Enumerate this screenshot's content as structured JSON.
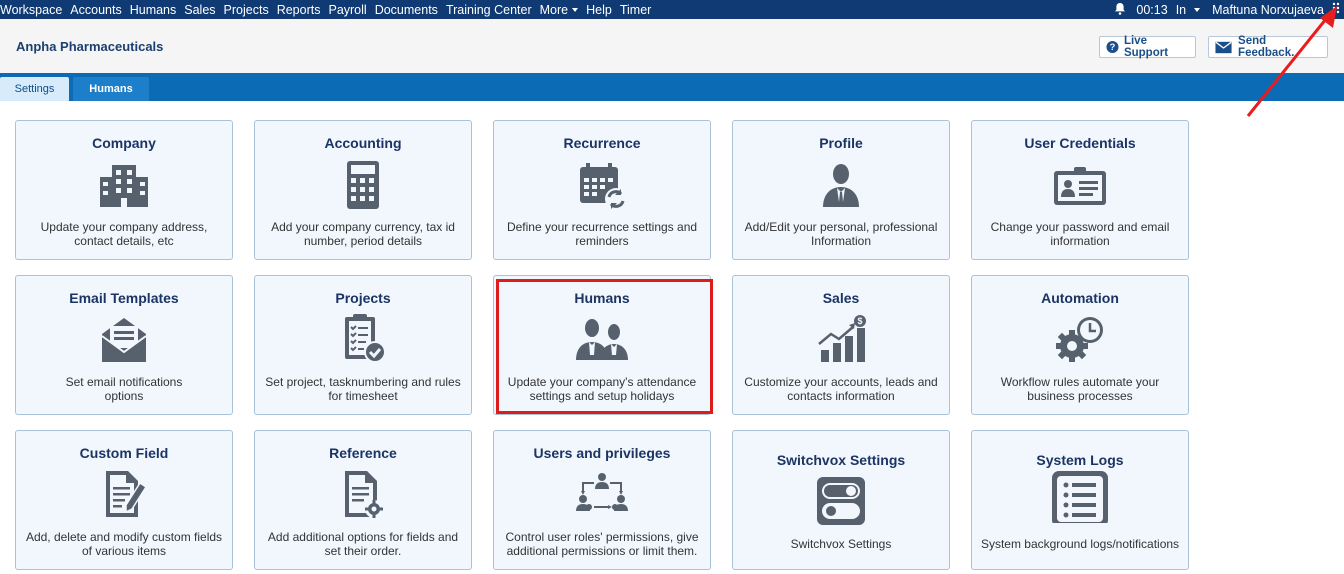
{
  "topnav": {
    "items": [
      "Workspace",
      "Accounts",
      "Humans",
      "Sales",
      "Projects",
      "Reports",
      "Payroll",
      "Documents",
      "Training Center",
      "More",
      "Help",
      "Timer"
    ],
    "time": "00:13",
    "status": "In",
    "user": "Maftuna Norxujaeva"
  },
  "header": {
    "company": "Anpha Pharmaceuticals",
    "live_support": "Live Support",
    "send_feedback": "Send Feedback."
  },
  "tabs": [
    "Settings",
    "Humans"
  ],
  "cards": [
    {
      "title": "Company",
      "icon": "building-icon",
      "desc1": "Update your company address,",
      "desc2": "contact details, etc"
    },
    {
      "title": "Accounting",
      "icon": "calculator-icon",
      "desc1": "Add your company currency, tax id",
      "desc2": "number, period details"
    },
    {
      "title": "Recurrence",
      "icon": "calendar-refresh-icon",
      "desc1": "Define your recurrence settings and",
      "desc2": "reminders"
    },
    {
      "title": "Profile",
      "icon": "person-icon",
      "desc1": "Add/Edit your personal, professional",
      "desc2": "Information"
    },
    {
      "title": "User Credentials",
      "icon": "id-card-icon",
      "desc1": "Change your password and email",
      "desc2": "information"
    },
    {
      "title": "Email Templates",
      "icon": "envelope-icon",
      "desc1": "Set email notifications",
      "desc2": "options"
    },
    {
      "title": "Projects",
      "icon": "clipboard-check-icon",
      "desc1": "Set project, tasknumbering and rules",
      "desc2": "for timesheet"
    },
    {
      "title": "Humans",
      "icon": "people-icon",
      "desc1": "Update your company's attendance",
      "desc2": "settings and setup holidays"
    },
    {
      "title": "Sales",
      "icon": "sales-chart-icon",
      "desc1": "Customize your accounts, leads and",
      "desc2": "contacts information"
    },
    {
      "title": "Automation",
      "icon": "gear-clock-icon",
      "desc1": "Workflow rules automate your",
      "desc2": "business processes"
    },
    {
      "title": "Custom Field",
      "icon": "document-edit-icon",
      "desc1": "Add, delete and modify custom fields",
      "desc2": "of various items"
    },
    {
      "title": "Reference",
      "icon": "document-gear-icon",
      "desc1": "Add additional options for fields and",
      "desc2": "set their order."
    },
    {
      "title": "Users and privileges",
      "icon": "users-network-icon",
      "desc1": "Control user roles' permissions, give",
      "desc2": "additional permissions or limit them."
    },
    {
      "title": "Switchvox Settings",
      "icon": "toggle-switch-icon",
      "desc1": "Switchvox Settings",
      "desc2": ""
    },
    {
      "title": "System Logs",
      "icon": "list-icon",
      "desc1": "System background logs/notifications",
      "desc2": ""
    }
  ]
}
